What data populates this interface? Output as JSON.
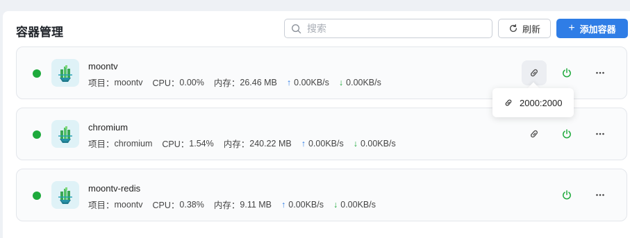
{
  "header": {
    "title": "容器管理",
    "search_placeholder": "搜索",
    "search_value": "",
    "refresh_label": "刷新",
    "add_label": "添加容器",
    "add_icon": "+"
  },
  "colors": {
    "accent": "#2f7de6",
    "running": "#1eaa3c"
  },
  "containers": [
    {
      "name": "moontv",
      "project_label": "项目：",
      "project": "moontv",
      "cpu_label": "CPU：",
      "cpu": "0.00%",
      "mem_label": "内存：",
      "mem": "26.46 MB",
      "up": "0.00KB/s",
      "down": "0.00KB/s",
      "status": "running",
      "has_port_link": true
    },
    {
      "name": "chromium",
      "project_label": "项目：",
      "project": "chromium",
      "cpu_label": "CPU：",
      "cpu": "1.54%",
      "mem_label": "内存：",
      "mem": "240.22 MB",
      "up": "0.00KB/s",
      "down": "0.00KB/s",
      "status": "running",
      "has_port_link": true
    },
    {
      "name": "moontv-redis",
      "project_label": "项目：",
      "project": "moontv",
      "cpu_label": "CPU：",
      "cpu": "0.38%",
      "mem_label": "内存：",
      "mem": "9.11 MB",
      "up": "0.00KB/s",
      "down": "0.00KB/s",
      "status": "running",
      "has_port_link": false
    }
  ],
  "tooltip": {
    "port_mapping": "2000:2000"
  },
  "icons": {
    "search": "search-icon",
    "refresh": "refresh-icon",
    "link": "link-icon",
    "power": "power-icon",
    "more": "more-icon",
    "arrow_up": "↑",
    "arrow_down": "↓"
  }
}
